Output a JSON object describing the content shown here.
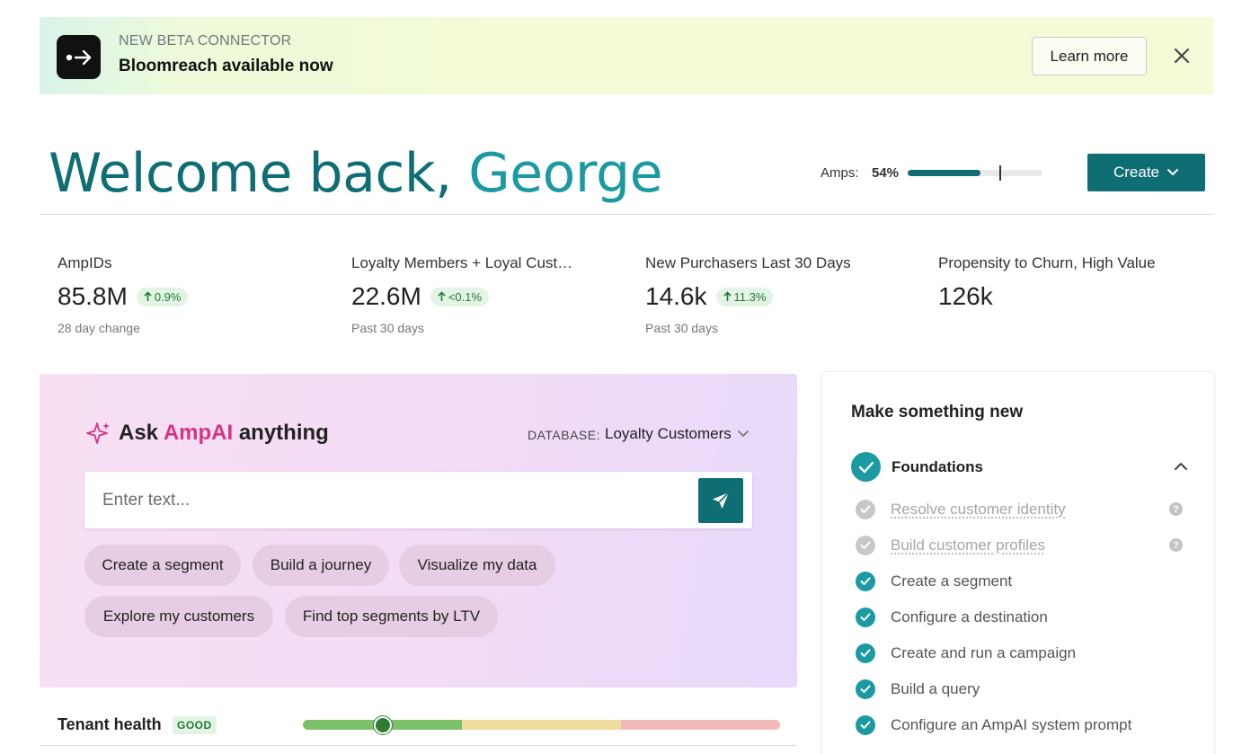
{
  "banner": {
    "eyebrow": "NEW BETA CONNECTOR",
    "title": "Bloomreach available now",
    "learn_more": "Learn more",
    "logo_icon": "arrow-right-icon",
    "close_icon": "close-icon"
  },
  "header": {
    "welcome_prefix": "Welcome back, ",
    "user_name": "George",
    "amps_label": "Amps:",
    "amps_value": "54%",
    "amps_fraction": 0.54,
    "amps_marker_fraction": 0.68,
    "create_label": "Create"
  },
  "stats": [
    {
      "label": "AmpIDs",
      "value": "85.8M",
      "delta": "0.9%",
      "sub": "28 day change"
    },
    {
      "label": "Loyalty Members + Loyal Cust…",
      "value": "22.6M",
      "delta": "<0.1%",
      "sub": "Past 30 days"
    },
    {
      "label": "New Purchasers Last 30 Days",
      "value": "14.6k",
      "delta": "11.3%",
      "sub": "Past 30 days"
    },
    {
      "label": "Propensity to Churn, High Value",
      "value": "126k",
      "delta": "",
      "sub": ""
    }
  ],
  "ai": {
    "title_prefix": "Ask ",
    "title_brand": "AmpAI",
    "title_suffix": " anything",
    "db_label": "DATABASE:",
    "db_value": "Loyalty Customers",
    "placeholder": "Enter text...",
    "chips": [
      "Create a segment",
      "Build a journey",
      "Visualize my data",
      "Explore my customers",
      "Find top segments by LTV"
    ]
  },
  "tenant": {
    "label": "Tenant health",
    "status": "GOOD",
    "health_fraction": 0.167
  },
  "make_new": {
    "title": "Make something new",
    "section": "Foundations",
    "tasks": [
      {
        "label": "Resolve customer identity",
        "done": false
      },
      {
        "label": "Build customer profiles",
        "done": false
      },
      {
        "label": "Create a segment",
        "done": true
      },
      {
        "label": "Configure a destination",
        "done": true
      },
      {
        "label": "Create and run a campaign",
        "done": true
      },
      {
        "label": "Build a query",
        "done": true
      },
      {
        "label": "Configure an AmpAI system prompt",
        "done": true
      }
    ]
  },
  "colors": {
    "brand_teal": "#0f6e74",
    "accent_teal": "#1c9aa2",
    "ai_pink": "#d63384",
    "good_green": "#1f7a35"
  }
}
